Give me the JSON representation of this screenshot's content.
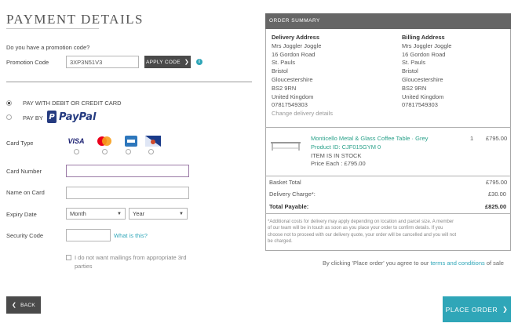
{
  "payment": {
    "title": "PAYMENT DETAILS",
    "promo_question": "Do you have a promotion code?",
    "promo_label": "Promotion Code",
    "promo_value": "3XP3N51V3",
    "apply_label": "APPLY CODE",
    "apply_icon": "chevron-right-icon",
    "help_icon": "info-icon",
    "pay_card_label": "PAY WITH DEBIT OR CREDIT CARD",
    "pay_by_label": "PAY BY",
    "paypal_label": "PayPal",
    "card_type_label": "Card Type",
    "cards": [
      "VISA",
      "mastercard",
      "amex",
      "maestro"
    ],
    "card_number_label": "Card Number",
    "name_on_card_label": "Name on Card",
    "expiry_label": "Expiry Date",
    "month_value": "Month",
    "year_value": "Year",
    "security_label": "Security Code",
    "what_is_this": "What is this?",
    "marketing_text_1": "I do not want mailings from appropriate 3rd",
    "marketing_text_2": "parties",
    "back_label": "BACK",
    "place_order_label": "PLACE ORDER"
  },
  "summary": {
    "header": "ORDER SUMMARY",
    "delivery_title": "Delivery Address",
    "billing_title": "Billing Address",
    "delivery_lines": [
      "Mrs Joggler Joggle",
      "16 Gordon Road",
      "St. Pauls",
      "Bristol",
      "Gloucestershire",
      "BS2 9RN",
      "United Kingdom",
      "07817549303"
    ],
    "billing_lines": [
      "Mrs Joggler Joggle",
      "16 Gordon Road",
      "St. Pauls",
      "Bristol",
      "Gloucestershire",
      "BS2 9RN",
      "United Kingdom",
      "07817549303"
    ],
    "change_delivery": "Change delivery details",
    "product_name": "Monticello Metal & Glass Coffee Table · Grey",
    "product_id": "Product ID: CJF015GYM 0",
    "stock": "ITEM IS IN STOCK",
    "price_each": "Price Each : £795.00",
    "qty": "1",
    "line_total": "£795.00",
    "basket_total_label": "Basket Total",
    "basket_total": "£795.00",
    "delivery_label": "Delivery Charge*:",
    "delivery_value": "£30.00",
    "payable_label": "Total Payable:",
    "payable_value": "£825.00",
    "note_lines": [
      "*Additional costs for delivery may apply depending on location and parcel size. A member",
      "of our team will be in touch as soon as you place your order to confirm details. If you",
      "choose not to proceed with our delivery quote, your order will be cancelled and you will not",
      "be charged."
    ],
    "agree_prefix": "By clicking 'Place order' you agree to our",
    "terms_link": "terms and conditions",
    "agree_suffix": "of sale"
  },
  "colors": {
    "accent": "#2fa6b8",
    "dark": "#4a4a4a",
    "header": "#666666",
    "product": "#2aa18a"
  }
}
